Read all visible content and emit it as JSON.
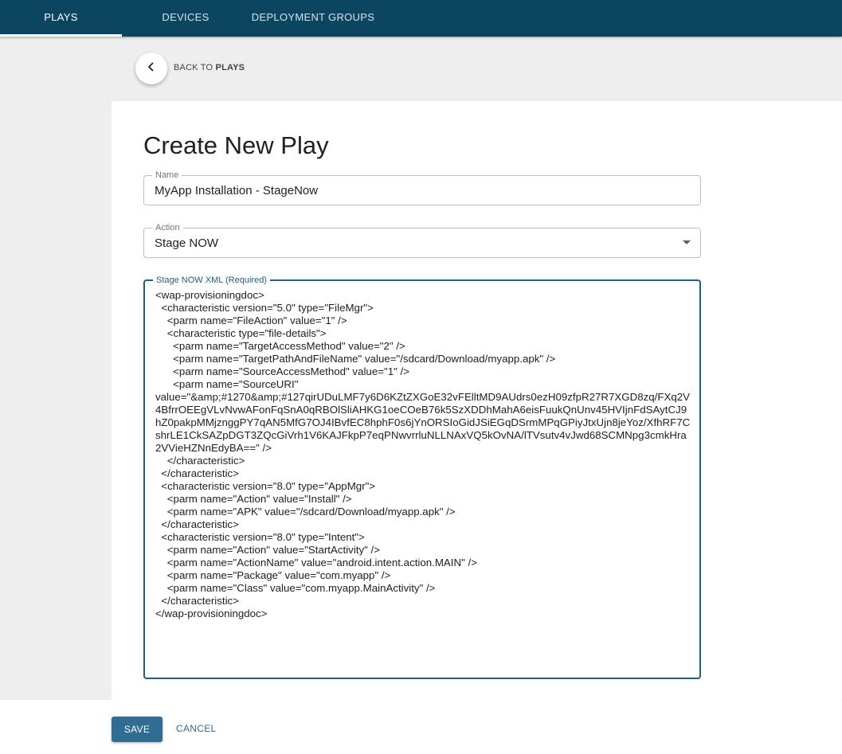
{
  "nav": {
    "tabs": [
      {
        "label": "PLAYS",
        "active": true
      },
      {
        "label": "DEVICES",
        "active": false
      },
      {
        "label": "DEPLOYMENT GROUPS",
        "active": false
      }
    ]
  },
  "back": {
    "icon": "chevron-left-icon",
    "prefix": "BACK TO ",
    "target": "PLAYS"
  },
  "form": {
    "title": "Create New Play",
    "name": {
      "label": "Name",
      "value": "MyApp Installation - StageNow"
    },
    "action": {
      "label": "Action",
      "value": "Stage NOW"
    },
    "xml": {
      "label": "Stage NOW XML (Required)",
      "value": "<wap-provisioningdoc>\n  <characteristic version=\"5.0\" type=\"FileMgr\">\n    <parm name=\"FileAction\" value=\"1\" />\n    <characteristic type=\"file-details\">\n      <parm name=\"TargetAccessMethod\" value=\"2\" />\n      <parm name=\"TargetPathAndFileName\" value=\"/sdcard/Download/myapp.apk\" />\n      <parm name=\"SourceAccessMethod\" value=\"1\" />\n      <parm name=\"SourceURI\"\nvalue=\"&amp;#1270&amp;#127qirUDuLMF7y6D6KZtZXGoE32vFElltMD9AUdrs0ezH09zfpR27R7XGD8zq/FXq2V4BfrrOEEgVLvNvwAFonFqSnA0qRBOlSliAHKG1oeCOeB76k5SzXDDhMahA6eisFuukQnUnv45HVIjnFdSAytCJ9hZ0pakpMMjznggPY7qAN5MfG7OJ4IBvfEC8hphF0s6jYnORSIoGidJSiEGqDSrmMPqGPiyJtxUjn8jeYoz/XfhRF7CshrLE1CkSAZpDGT3ZQcGiVrh1V6KAJFkpP7eqPNwvrrluNLLNAxVQ5kOvNA/lTVsutv4vJwd68SCMNpg3cmkHra2VVieHZNnEdyBA==\" />\n    </characteristic>\n  </characteristic>\n  <characteristic version=\"8.0\" type=\"AppMgr\">\n    <parm name=\"Action\" value=\"Install\" />\n    <parm name=\"APK\" value=\"/sdcard/Download/myapp.apk\" />\n  </characteristic>\n  <characteristic version=\"8.0\" type=\"Intent\">\n    <parm name=\"Action\" value=\"StartActivity\" />\n    <parm name=\"ActionName\" value=\"android.intent.action.MAIN\" />\n    <parm name=\"Package\" value=\"com.myapp\" />\n    <parm name=\"Class\" value=\"com.myapp.MainActivity\" />\n  </characteristic>\n</wap-provisioningdoc>"
    }
  },
  "actions": {
    "save_label": "SAVE",
    "cancel_label": "CANCEL"
  },
  "colors": {
    "topbar": "#0b4660",
    "primary": "#2f6d93",
    "focus": "#1f5f80"
  }
}
